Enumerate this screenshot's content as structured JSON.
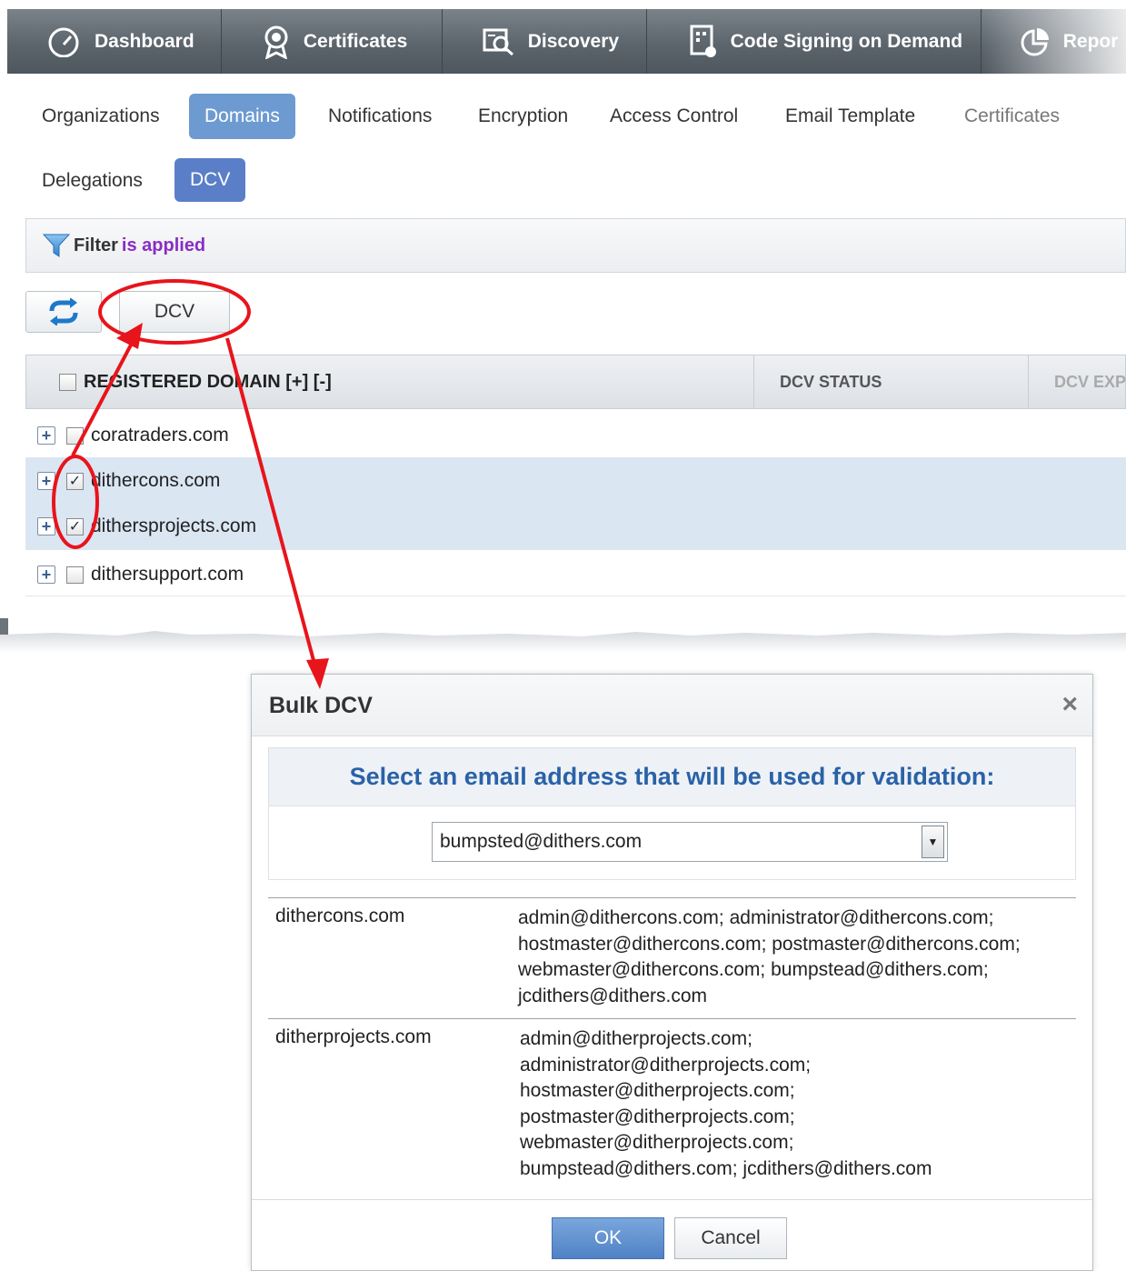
{
  "topnav": {
    "items": [
      {
        "label": "Dashboard",
        "icon": "speedometer-icon"
      },
      {
        "label": "Certificates",
        "icon": "certificate-badge-icon"
      },
      {
        "label": "Discovery",
        "icon": "discovery-search-icon"
      },
      {
        "label": "Code Signing on Demand",
        "icon": "code-signing-icon"
      },
      {
        "label": "Repor",
        "icon": "reports-pie-icon"
      }
    ]
  },
  "subtabs": {
    "row1": [
      "Organizations",
      "Domains",
      "Notifications",
      "Encryption",
      "Access Control",
      "Email Template",
      "Certificates"
    ],
    "row2": [
      "Delegations",
      "DCV"
    ],
    "active": [
      "Domains",
      "DCV"
    ]
  },
  "filter": {
    "label": "Filter",
    "status": "is applied"
  },
  "toolbar": {
    "refresh_icon": "refresh-icon",
    "dcv_label": "DCV"
  },
  "grid": {
    "columns": [
      "REGISTERED DOMAIN [+] [-]",
      "DCV STATUS",
      "DCV EXP"
    ],
    "rows": [
      {
        "domain": "coratraders.com",
        "checked": false
      },
      {
        "domain": "dithercons.com",
        "checked": true
      },
      {
        "domain": "dithersprojects.com",
        "checked": true
      },
      {
        "domain": "dithersupport.com",
        "checked": false
      }
    ]
  },
  "dialog": {
    "title": "Bulk DCV",
    "close": "×",
    "prompt": "Select an email address that will be used for validation:",
    "selected_email": "bumpsted@dithers.com",
    "domains": [
      {
        "name": "dithercons.com",
        "emails": [
          "admin@dithercons.com; administrator@dithercons.com;",
          "hostmaster@dithercons.com; postmaster@dithercons.com;",
          "webmaster@dithercons.com; bumpstead@dithers.com;",
          "jcdithers@dithers.com"
        ]
      },
      {
        "name": "ditherprojects.com",
        "emails": [
          "admin@ditherprojects.com;",
          "administrator@ditherprojects.com;",
          "hostmaster@ditherprojects.com;",
          "postmaster@ditherprojects.com;",
          "webmaster@ditherprojects.com;",
          "bumpstead@dithers.com; jcdithers@dithers.com"
        ]
      }
    ],
    "ok_label": "OK",
    "cancel_label": "Cancel"
  },
  "colors": {
    "nav_bg": "#5c646c",
    "active_tab": "#6d9bd1",
    "prompt_text": "#2a62a8",
    "annotation_red": "#e8141b",
    "selected_row": "#dbe6f3"
  }
}
